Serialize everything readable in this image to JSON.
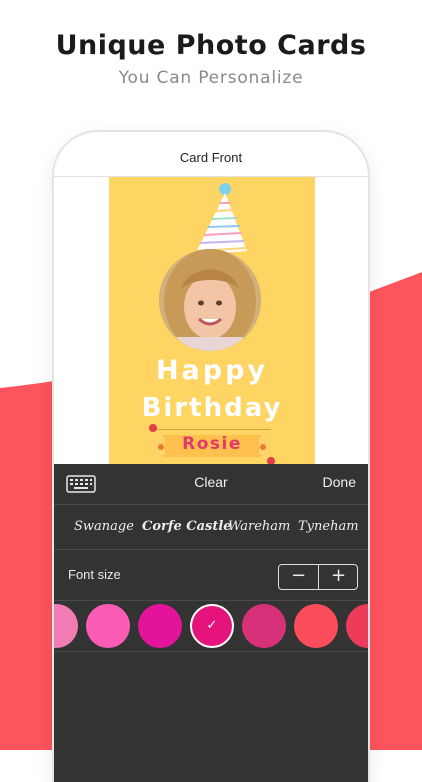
{
  "headline": "Unique Photo Cards",
  "subline": "You Can Personalize",
  "colors": {
    "accent_red": "#fe545c",
    "card_yellow": "#fed462",
    "panel_dark": "#333333"
  },
  "nav": {
    "title": "Card Front"
  },
  "card": {
    "line1": "Happy",
    "line2": "Birthday",
    "name": "Rosie"
  },
  "toolbar": {
    "keyboard_icon": "keyboard-icon",
    "clear_label": "Clear",
    "done_label": "Done"
  },
  "fonts": {
    "options": [
      "Swanage",
      "Corfe Castle",
      "Wareham",
      "Tyneham"
    ]
  },
  "font_size": {
    "label": "Font size",
    "decrease": "−",
    "increase": "+"
  },
  "swatches": {
    "colors": [
      "#f27cb4",
      "#fb5cb6",
      "#e4149a",
      "#e4147c",
      "#d7317a",
      "#fb4c5c",
      "#ed3c5a"
    ],
    "selected_index": 3,
    "check": "✓"
  }
}
